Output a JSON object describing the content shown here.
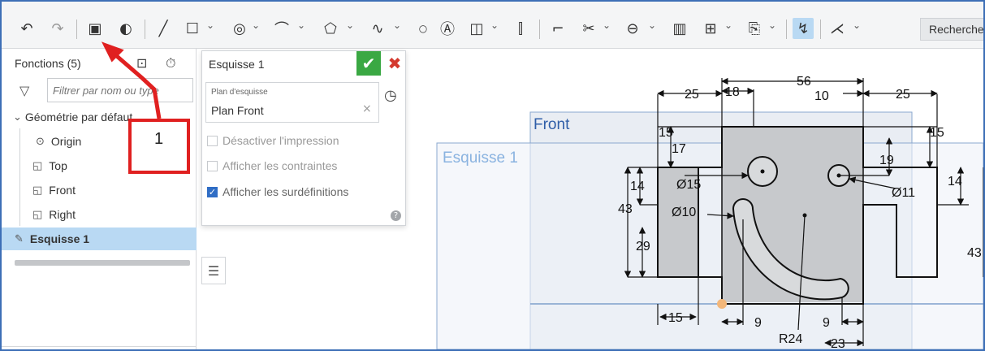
{
  "toolbar": {
    "search_label": "Recherche"
  },
  "features": {
    "title": "Fonctions (5)",
    "filter_placeholder": "Filtrer par nom ou type",
    "group_label": "Géométrie par défaut",
    "items": [
      {
        "label": "Origin"
      },
      {
        "label": "Top"
      },
      {
        "label": "Front"
      },
      {
        "label": "Right"
      },
      {
        "label": "Esquisse 1"
      }
    ]
  },
  "dialog": {
    "title": "Esquisse 1",
    "plane_label": "Plan d'esquisse",
    "plane_value": "Plan Front",
    "options": [
      {
        "label": "Désactiver l'impression",
        "checked": false
      },
      {
        "label": "Afficher les contraintes",
        "checked": false
      },
      {
        "label": "Afficher les surdéfinitions",
        "checked": true
      }
    ]
  },
  "annotation": {
    "number": "1"
  },
  "canvas": {
    "plane_front_label": "Front",
    "sketch_label": "Esquisse 1",
    "dimensions": {
      "d56": "56",
      "d18": "18",
      "d25a": "25",
      "d10": "10",
      "d25b": "25",
      "d15a": "15",
      "d17": "17",
      "d15b": "15",
      "d19": "19",
      "dia15": "Ø15",
      "dia11": "Ø11",
      "dia10": "Ø10",
      "d14a": "14",
      "d14b": "14",
      "d43a": "43",
      "d43b": "43",
      "d29": "29",
      "d15c": "15",
      "d9a": "9",
      "d9b": "9",
      "r24": "R24",
      "d23": "23"
    }
  },
  "colors": {
    "accent": "#2f6dc5",
    "ok_green": "#3aa843",
    "cancel_red": "#d43a2f",
    "selection": "#b9d9f3",
    "plane_blue": "#3d6fb6",
    "annotation_red": "#e02020"
  }
}
